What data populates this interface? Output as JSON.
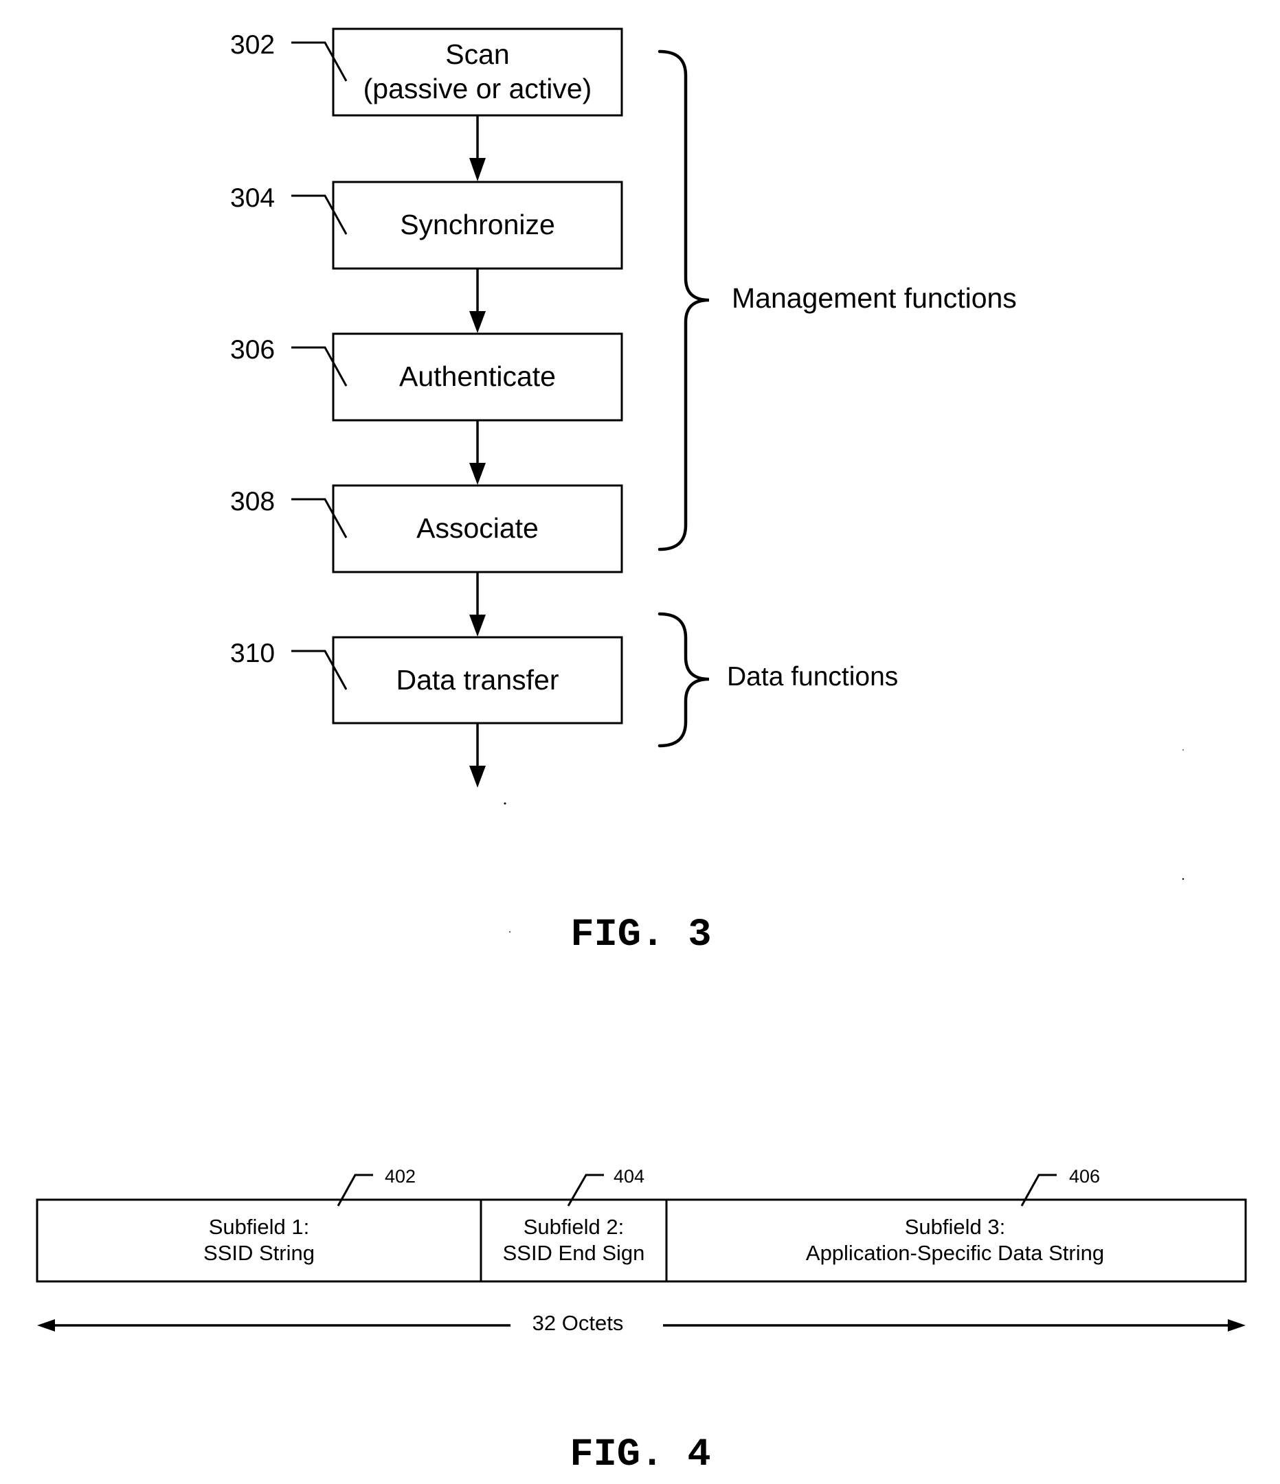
{
  "fig3": {
    "caption": "FIG. 3",
    "steps": [
      {
        "ref": "302",
        "lines": [
          "Scan",
          "(passive or active)"
        ]
      },
      {
        "ref": "304",
        "lines": [
          "Synchronize"
        ]
      },
      {
        "ref": "306",
        "lines": [
          "Authenticate"
        ]
      },
      {
        "ref": "308",
        "lines": [
          "Associate"
        ]
      },
      {
        "ref": "310",
        "lines": [
          "Data transfer"
        ]
      }
    ],
    "groups": [
      {
        "label": "Management functions",
        "steps": [
          "302",
          "304",
          "306",
          "308"
        ]
      },
      {
        "label": "Data functions",
        "steps": [
          "310"
        ]
      }
    ]
  },
  "fig4": {
    "caption": "FIG. 4",
    "fields": [
      {
        "ref": "402",
        "lines": [
          "Subfield 1:",
          "SSID String"
        ]
      },
      {
        "ref": "404",
        "lines": [
          "Subfield 2:",
          "SSID End Sign"
        ]
      },
      {
        "ref": "406",
        "lines": [
          "Subfield 3:",
          "Application-Specific Data String"
        ]
      }
    ],
    "span_label": "32 Octets"
  }
}
